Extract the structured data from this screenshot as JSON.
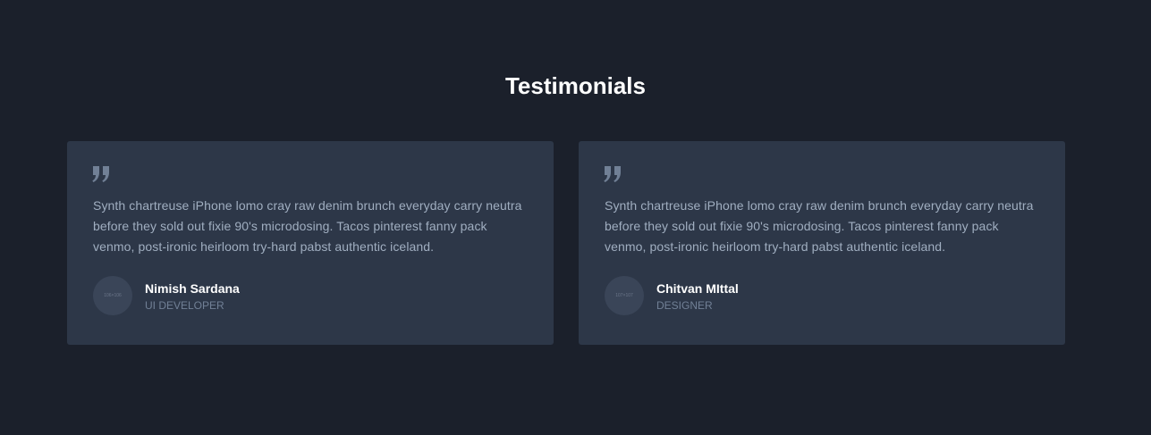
{
  "section": {
    "title": "Testimonials"
  },
  "testimonials": [
    {
      "quote": "Synth chartreuse iPhone lomo cray raw denim brunch everyday carry neutra before they sold out fixie 90's microdosing. Tacos pinterest fanny pack venmo, post-ironic heirloom try-hard pabst authentic iceland.",
      "avatar_text": "106×106",
      "name": "Nimish Sardana",
      "role": "UI DEVELOPER"
    },
    {
      "quote": "Synth chartreuse iPhone lomo cray raw denim brunch everyday carry neutra before they sold out fixie 90's microdosing. Tacos pinterest fanny pack venmo, post-ironic heirloom try-hard pabst authentic iceland.",
      "avatar_text": "107×107",
      "name": "Chitvan MIttal",
      "role": "DESIGNER"
    }
  ],
  "icons": {
    "quote": "quote-icon"
  },
  "colors": {
    "background": "#1b202b",
    "card": "#2d3748",
    "quote_icon": "#718096",
    "body_text": "#a0aec0",
    "name_text": "#ffffff",
    "role_text": "#718096"
  }
}
